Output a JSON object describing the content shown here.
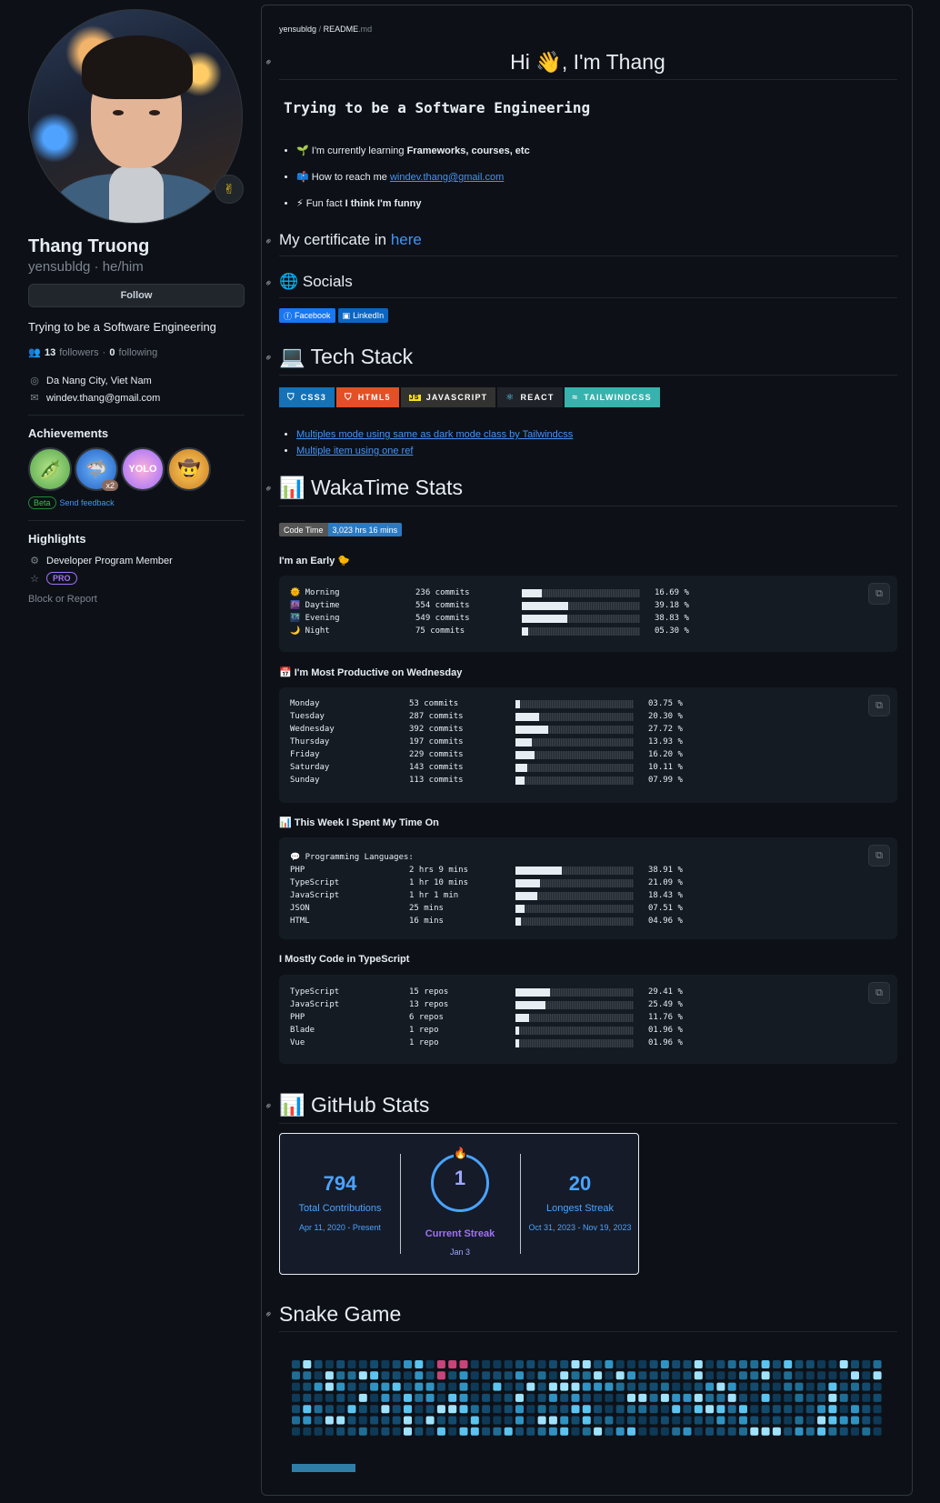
{
  "profile": {
    "fullname": "Thang Truong",
    "login": "yensubldg · he/him",
    "follow_label": "Follow",
    "bio": "Trying to be a Software Engineering",
    "followers_count": "13",
    "followers_label": "followers",
    "following_count": "0",
    "following_label": "following",
    "location": "Da Nang City, Viet Nam",
    "email": "windev.thang@gmail.com",
    "status_emoji": "✌"
  },
  "achievements": {
    "title": "Achievements",
    "badges": [
      "🫛",
      "🦈",
      "YOLO",
      "🤠"
    ],
    "multiplier": "x2",
    "beta": "Beta",
    "feedback": "Send feedback"
  },
  "highlights": {
    "title": "Highlights",
    "member": "Developer Program Member",
    "pro": "PRO",
    "block": "Block or Report"
  },
  "readme": {
    "crumb_user": "yensubldg",
    "crumb_sep": "/",
    "crumb_file": "README",
    "crumb_ext": ".md",
    "greeting": "Hi 👋, I'm Thang",
    "tagline": "Trying to be a Software Engineering",
    "bullets": [
      {
        "emoji": "🌱",
        "prefix": "I'm currently learning ",
        "bold": "Frameworks, courses, etc"
      },
      {
        "emoji": "📫",
        "prefix": "How to reach me ",
        "link": "windev.thang@gmail.com"
      },
      {
        "emoji": "⚡",
        "prefix": "Fun fact ",
        "bold": "I think I'm funny"
      }
    ],
    "certificate_prefix": "My certificate in ",
    "certificate_link": "here",
    "socials_title": "🌐 Socials",
    "social_badges": [
      "Facebook",
      "LinkedIn"
    ],
    "tech_title": "💻 Tech Stack",
    "tech_badges": [
      "CSS3",
      "HTML5",
      "JAVASCRIPT",
      "REACT",
      "TAILWINDCSS"
    ],
    "tech_links": [
      "Multiples mode using same as dark mode class by Tailwindcss",
      "Multiple item using one ref"
    ],
    "waka_title": "📊 WakaTime Stats",
    "code_time_label": "Code Time",
    "code_time_value": "3,023 hrs 16 mins",
    "early_title": "I'm an Early 🐤",
    "productive_title": "📅 I'm Most Productive on Wednesday",
    "week_title": "📊 This Week I Spent My Time On",
    "languages_header": "💬 Programming Languages:",
    "mostly_title": "I Mostly Code in TypeScript",
    "github_title": "📊 GitHub Stats",
    "snake_title": "Snake Game"
  },
  "early": [
    {
      "icon": "🌞",
      "name": "Morning",
      "value": "236 commits",
      "pct": "16.69 %",
      "fraction": 0.1669
    },
    {
      "icon": "🌆",
      "name": "Daytime",
      "value": "554 commits",
      "pct": "39.18 %",
      "fraction": 0.3918
    },
    {
      "icon": "🌃",
      "name": "Evening",
      "value": "549 commits",
      "pct": "38.83 %",
      "fraction": 0.3883
    },
    {
      "icon": "🌙",
      "name": "Night",
      "value": "75 commits",
      "pct": "05.30 %",
      "fraction": 0.053
    }
  ],
  "weekdays": [
    {
      "name": "Monday",
      "value": "53 commits",
      "pct": "03.75 %",
      "fraction": 0.0375
    },
    {
      "name": "Tuesday",
      "value": "287 commits",
      "pct": "20.30 %",
      "fraction": 0.203
    },
    {
      "name": "Wednesday",
      "value": "392 commits",
      "pct": "27.72 %",
      "fraction": 0.2772
    },
    {
      "name": "Thursday",
      "value": "197 commits",
      "pct": "13.93 %",
      "fraction": 0.1393
    },
    {
      "name": "Friday",
      "value": "229 commits",
      "pct": "16.20 %",
      "fraction": 0.162
    },
    {
      "name": "Saturday",
      "value": "143 commits",
      "pct": "10.11 %",
      "fraction": 0.1011
    },
    {
      "name": "Sunday",
      "value": "113 commits",
      "pct": "07.99 %",
      "fraction": 0.0799
    }
  ],
  "languages": [
    {
      "name": "PHP",
      "value": "2 hrs 9 mins",
      "pct": "38.91 %",
      "fraction": 0.3891
    },
    {
      "name": "TypeScript",
      "value": "1 hr 10 mins",
      "pct": "21.09 %",
      "fraction": 0.2109
    },
    {
      "name": "JavaScript",
      "value": "1 hr 1 min",
      "pct": "18.43 %",
      "fraction": 0.1843
    },
    {
      "name": "JSON",
      "value": "25 mins",
      "pct": "07.51 %",
      "fraction": 0.0751
    },
    {
      "name": "HTML",
      "value": "16 mins",
      "pct": "04.96 %",
      "fraction": 0.0496
    }
  ],
  "repos": [
    {
      "name": "TypeScript",
      "value": "15 repos",
      "pct": "29.41 %",
      "fraction": 0.2941
    },
    {
      "name": "JavaScript",
      "value": "13 repos",
      "pct": "25.49 %",
      "fraction": 0.2549
    },
    {
      "name": "PHP",
      "value": "6 repos",
      "pct": "11.76 %",
      "fraction": 0.1176
    },
    {
      "name": "Blade",
      "value": "1 repo",
      "pct": "01.96 %",
      "fraction": 0.0196
    },
    {
      "name": "Vue",
      "value": "1 repo",
      "pct": "01.96 %",
      "fraction": 0.0196
    }
  ],
  "streak": {
    "total": "794",
    "total_label": "Total Contributions",
    "total_range": "Apr 11, 2020 - Present",
    "current": "1",
    "current_label": "Current Streak",
    "current_date": "Jan 3",
    "longest": "20",
    "longest_label": "Longest Streak",
    "longest_range": "Oct 31, 2023 - Nov 19, 2023"
  },
  "colors": {
    "accent": "#4493f8",
    "streak_blue": "#4aa3ff",
    "streak_purple": "#a371f7",
    "snake_head": "#c8447a"
  }
}
